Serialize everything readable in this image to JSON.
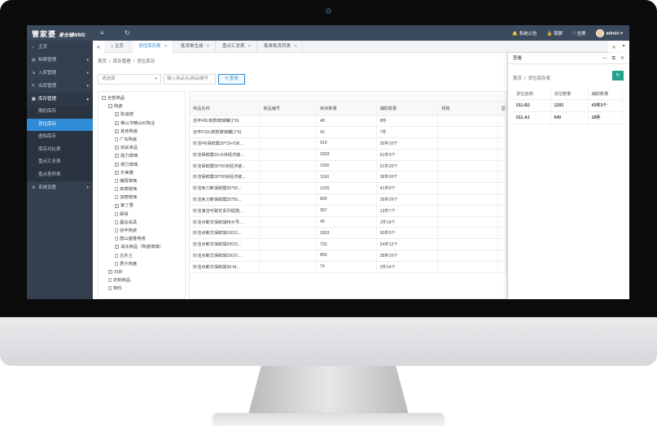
{
  "app": {
    "logo_main": "管家婆",
    "logo_sub": "易仓储WMS",
    "menu_icon": "menu-icon",
    "refresh_icon": "refresh-icon",
    "notice": "系统公告",
    "lock": "锁屏",
    "fullscreen": "全屏",
    "user": "admin"
  },
  "sidebar": {
    "items": [
      {
        "label": "主页"
      },
      {
        "label": "档案管理"
      },
      {
        "label": "入库管理"
      },
      {
        "label": "出库管理"
      },
      {
        "label": "库存管理"
      }
    ],
    "sub": [
      {
        "label": "期初库存"
      },
      {
        "label": "货位库存"
      },
      {
        "label": "虚拟库存"
      },
      {
        "label": "库存对比表"
      },
      {
        "label": "盘点汇总表"
      },
      {
        "label": "盘点差异表"
      }
    ],
    "settings": "系统设置"
  },
  "tabs": [
    {
      "label": "主页"
    },
    {
      "label": "货位库存表"
    },
    {
      "label": "拣货单生成"
    },
    {
      "label": "盘点汇总表"
    },
    {
      "label": "拣单拣货列表"
    }
  ],
  "content": {
    "breadcrumb": [
      "首页",
      "库存管理",
      "货位库存"
    ],
    "select_placeholder": "请选择",
    "search_placeholder": "输入商品名|商品编号",
    "search_button": "查询",
    "tree": [
      {
        "label": "全部商品",
        "level": 0,
        "box": "−"
      },
      {
        "label": "陶瓷",
        "level": 1,
        "box": "−"
      },
      {
        "label": "陈诚德",
        "level": 2,
        "box": "+"
      },
      {
        "label": "佛山市精山红陶业",
        "level": 2,
        "box": "+"
      },
      {
        "label": "其他陶瓷",
        "level": 2,
        "box": "+"
      },
      {
        "label": "广东陶瓷",
        "level": 2,
        "box": ""
      },
      {
        "label": "琉采单品",
        "level": 2,
        "box": "+"
      },
      {
        "label": "能力玻璃",
        "level": 2,
        "box": "+"
      },
      {
        "label": "德力玻璃",
        "level": 2,
        "box": "+"
      },
      {
        "label": "乐美雅",
        "level": 2,
        "box": "+"
      },
      {
        "label": "瑰丽玻璃",
        "level": 2,
        "box": ""
      },
      {
        "label": "高德玻璃",
        "level": 2,
        "box": ""
      },
      {
        "label": "加德玻璃",
        "level": 2,
        "box": ""
      },
      {
        "label": "紫丁香",
        "level": 2,
        "box": "+"
      },
      {
        "label": "颐得",
        "level": 2,
        "box": ""
      },
      {
        "label": "晶钰采具",
        "level": 2,
        "box": ""
      },
      {
        "label": "创丰陶瓷",
        "level": 2,
        "box": ""
      },
      {
        "label": "唐山盛隆骨瓷",
        "level": 2,
        "box": ""
      },
      {
        "label": "淘汰商品（陶瓷玻璃）",
        "level": 2,
        "box": "+"
      },
      {
        "label": "古杰士",
        "level": 2,
        "box": ""
      },
      {
        "label": "君子商盘",
        "level": 2,
        "box": ""
      },
      {
        "label": "日杂",
        "level": 1,
        "box": "+"
      },
      {
        "label": "定制商品",
        "level": 1,
        "box": ""
      },
      {
        "label": "物料",
        "level": 1,
        "box": ""
      }
    ],
    "columns": [
      "商品名称",
      "商品编号",
      "库存数量",
      "辅助数量",
      "规格",
      "型"
    ],
    "rows": [
      [
        "创丰F8L新款玻璃罐(1*6)",
        "",
        "48",
        "8件",
        "",
        ""
      ],
      [
        "创丰F10L新款玻璃罐(1*6)",
        "",
        "42",
        "7件",
        "",
        ""
      ],
      [
        "妙洁PE保鲜膜30*15+5米...",
        "",
        "910",
        "30件10个",
        "",
        ""
      ],
      [
        "妙洁保鲜膜15+5米经济装...",
        "",
        "1833",
        "61件3个",
        "",
        ""
      ],
      [
        "妙洁保鲜膜30*50米经济装...",
        "",
        "1550",
        "51件20个",
        "",
        ""
      ],
      [
        "妙洁保鲜膜30*50米经济装...",
        "",
        "1160",
        "38件20个",
        "",
        ""
      ],
      [
        "妙洁免刀断保鲜膜30*50...",
        "",
        "1239",
        "41件9个",
        "",
        ""
      ],
      [
        "妙洁免刀断保鲜膜25*50...",
        "",
        "899",
        "29件29个",
        "",
        ""
      ],
      [
        "妙洁滴洁可致优系列铝箔...",
        "",
        "397",
        "13件7个",
        "",
        ""
      ],
      [
        "妙洁点断式保鲜袋特大号...",
        "",
        "49",
        "1件19个",
        "",
        ""
      ],
      [
        "妙洁点断式保鲜袋150只...",
        "",
        "1803",
        "60件3个",
        "",
        ""
      ],
      [
        "妙洁点断式保鲜袋200只...",
        "",
        "732",
        "24件12个",
        "",
        ""
      ],
      [
        "妙洁点断式保鲜袋250只...",
        "",
        "856",
        "28件16个",
        "",
        ""
      ],
      [
        "妙洁点断式保鲜袋30-M...",
        "",
        "74",
        "2件14个",
        "",
        ""
      ]
    ]
  },
  "panel": {
    "title": "查看",
    "breadcrumb": [
      "首页",
      "货位库存表"
    ],
    "columns": [
      "货位名称",
      "货位数量",
      "辅助数量"
    ],
    "rows": [
      [
        "011-B2",
        "1293",
        "43件3个"
      ],
      [
        "011-A1",
        "540",
        "18件"
      ]
    ]
  }
}
